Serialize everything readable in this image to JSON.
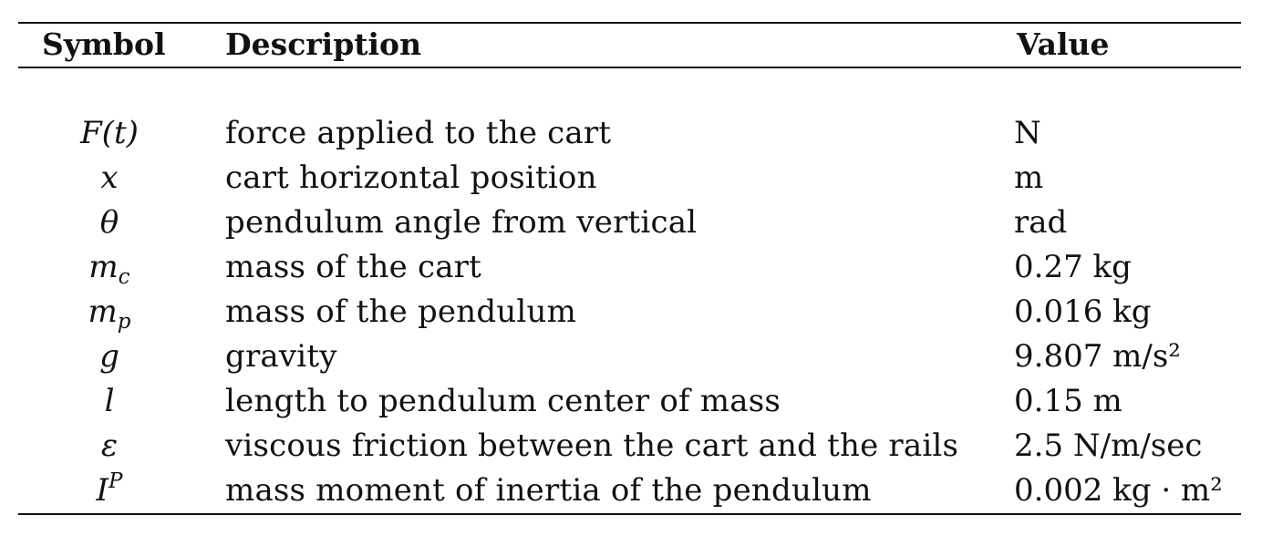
{
  "table": {
    "headers": {
      "symbol": "Symbol",
      "description": "Description",
      "value": "Value"
    },
    "rows": [
      {
        "symbol": "F(t)",
        "symbol_sub": "",
        "symbol_sup": "",
        "description": "force applied to the cart",
        "value": "N"
      },
      {
        "symbol": "x",
        "symbol_sub": "",
        "symbol_sup": "",
        "description": "cart horizontal position",
        "value": "m"
      },
      {
        "symbol": "θ",
        "symbol_sub": "",
        "symbol_sup": "",
        "description": "pendulum angle from vertical",
        "value": "rad"
      },
      {
        "symbol": "m",
        "symbol_sub": "c",
        "symbol_sup": "",
        "description": "mass of the cart",
        "value": "0.27 kg"
      },
      {
        "symbol": "m",
        "symbol_sub": "p",
        "symbol_sup": "",
        "description": "mass of the pendulum",
        "value": "0.016 kg"
      },
      {
        "symbol": "g",
        "symbol_sub": "",
        "symbol_sup": "",
        "description": "gravity",
        "value": "9.807 m/s²"
      },
      {
        "symbol": "l",
        "symbol_sub": "",
        "symbol_sup": "",
        "description": "length to pendulum center of mass",
        "value": "0.15 m"
      },
      {
        "symbol": "ε",
        "symbol_sub": "",
        "symbol_sup": "",
        "description": "viscous friction between the cart and the rails",
        "value": "2.5 N/m/sec"
      },
      {
        "symbol": "I",
        "symbol_sub": "",
        "symbol_sup": "P",
        "description": "mass moment of inertia of the pendulum",
        "value": "0.002 kg · m²"
      }
    ]
  }
}
